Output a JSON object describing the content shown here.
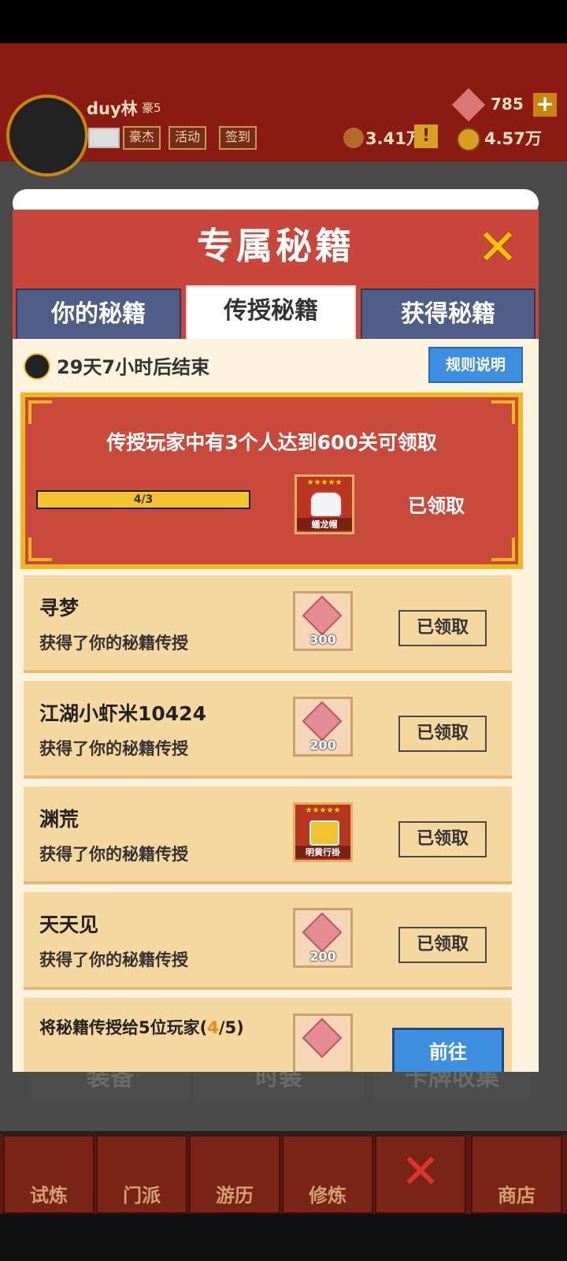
{
  "header": {
    "username": "duy林",
    "vip": "豪5",
    "buttons": [
      "豪杰",
      "活动",
      "签到"
    ],
    "gems": "785",
    "plus": "+",
    "currency1": "3.41万",
    "warn": "!",
    "currency2": "4.57万"
  },
  "modal": {
    "title": "专属秘籍",
    "close": "✕",
    "tabs": [
      "你的秘籍",
      "传授秘籍",
      "获得秘籍"
    ],
    "timer": "29天7小时后结束",
    "rules_button": "规则说明",
    "goal": {
      "text": "传授玩家中有3个人达到600关可领取",
      "progress_label": "4/3",
      "progress_fraction": 1.0,
      "reward_name": "蟠龙帽",
      "reward_stars": "★★★★★",
      "status": "已领取"
    },
    "rows": [
      {
        "name": "寻梦",
        "desc": "获得了你的秘籍传授",
        "item_count": "300",
        "status": "已领取"
      },
      {
        "name": "江湖小虾米10424",
        "desc": "获得了你的秘籍传授",
        "item_count": "200",
        "status": "已领取"
      },
      {
        "name": "渊荒",
        "desc": "获得了你的秘籍传授",
        "item_name": "明黄行褂",
        "item_stars": "★★★★★",
        "status": "已领取"
      },
      {
        "name": "天天见",
        "desc": "获得了你的秘籍传授",
        "item_count": "200",
        "status": "已领取"
      }
    ],
    "last_row": {
      "text_prefix": "将秘籍传授给5位玩家(",
      "current": "4",
      "sep": "/",
      "total": "5",
      "text_suffix": ")",
      "goto": "前往"
    }
  },
  "background_tabs": [
    "装备",
    "时装",
    "卡牌收集"
  ],
  "bottom_nav": [
    "试炼",
    "门派",
    "游历",
    "修炼",
    "",
    "商店"
  ],
  "colors": {
    "modal_red": "#c9473a",
    "tab_blue": "#4f5d87",
    "gold": "#f0b820",
    "button_blue": "#3f8fe0",
    "panel_bg": "#fdf3df",
    "row_bg": "#f5d7a0"
  }
}
